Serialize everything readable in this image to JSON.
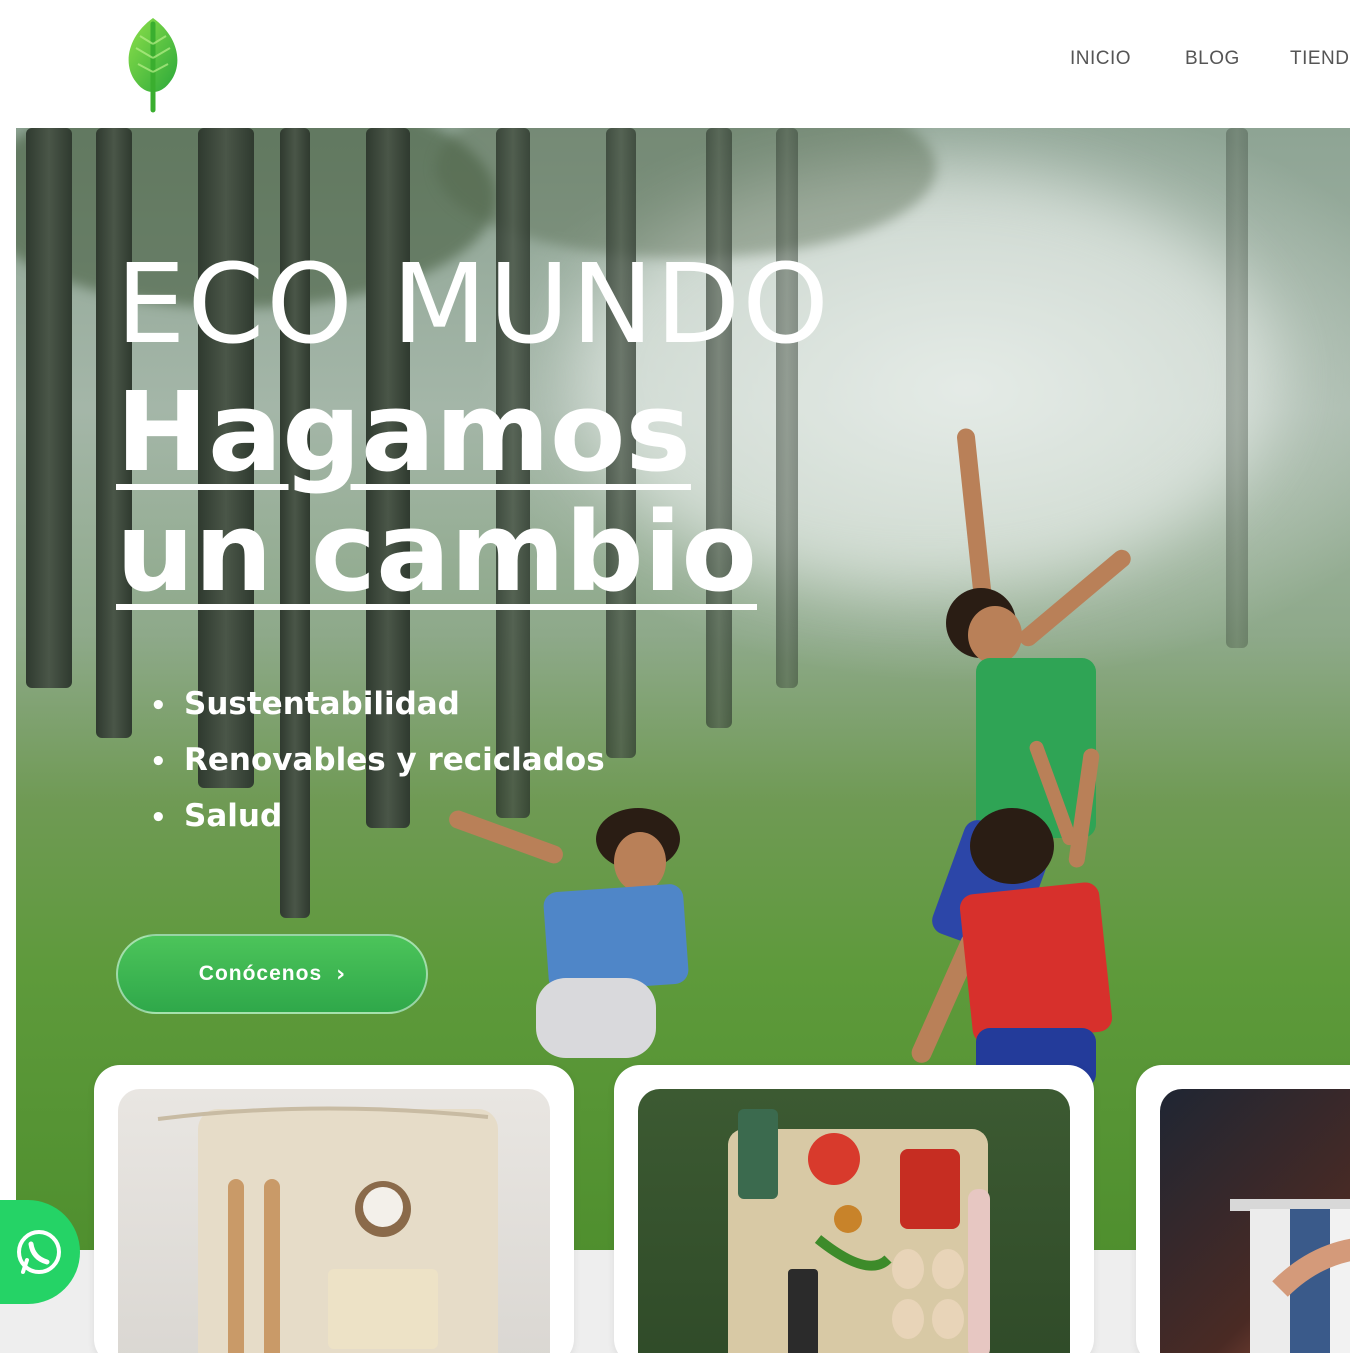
{
  "brand": {
    "logo_icon": "leaf-icon",
    "accent": "#3cba4c"
  },
  "nav": {
    "items": [
      "INICIO",
      "BLOG",
      "TIEND"
    ]
  },
  "hero": {
    "title_line1": "ECO MUNDO",
    "title_line2": "Hagamos",
    "title_line3": "un cambio",
    "bullets": [
      "Sustentabilidad",
      "Renovables y reciclados",
      "Salud"
    ],
    "cta_label": "Conócenos",
    "cta_icon": "chevron-right-icon"
  },
  "cards": [
    {
      "name": "eco-products-card"
    },
    {
      "name": "groceries-card"
    },
    {
      "name": "clothing-card"
    }
  ],
  "floating": {
    "whatsapp_icon": "whatsapp-icon",
    "color": "#25d366"
  }
}
